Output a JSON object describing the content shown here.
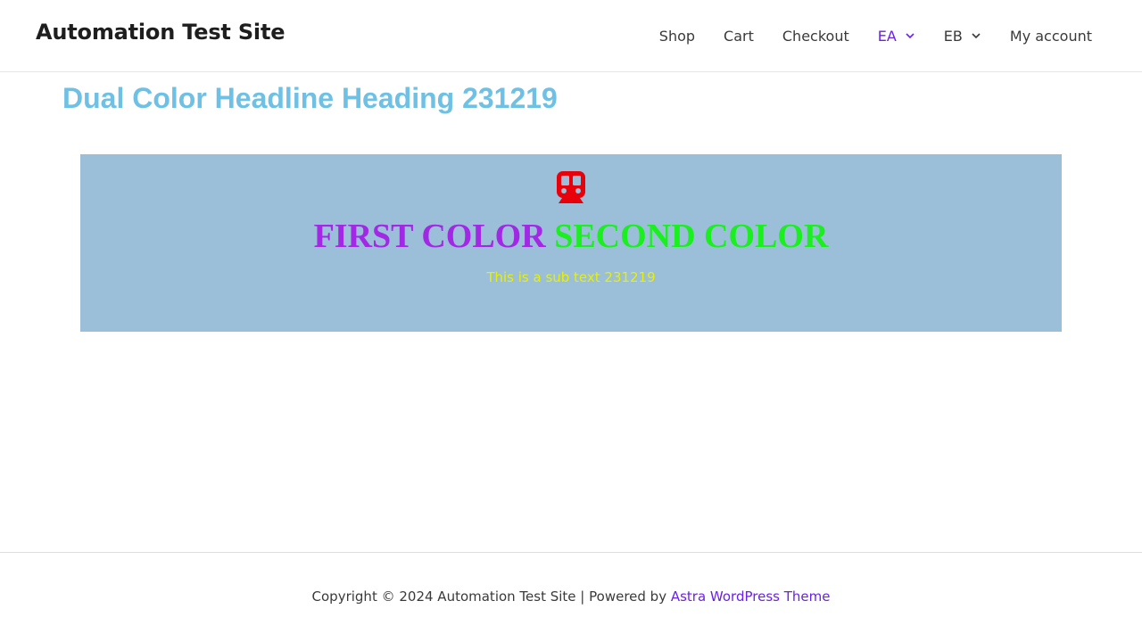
{
  "header": {
    "site_title": "Automation Test Site",
    "nav": [
      {
        "label": "Shop"
      },
      {
        "label": "Cart"
      },
      {
        "label": "Checkout"
      },
      {
        "label": "EA",
        "has_dropdown": true,
        "active": true
      },
      {
        "label": "EB",
        "has_dropdown": true
      },
      {
        "label": "My account"
      }
    ]
  },
  "main": {
    "heading": "Dual Color Headline Heading 231219",
    "dual_headline": {
      "icon": "subway-train-icon",
      "first": "FIRST COLOR",
      "second": "SECOND COLOR",
      "sub_text": "This is a sub text 231219"
    }
  },
  "footer": {
    "copyright": "Copyright © 2024 Automation Test Site | Powered by ",
    "link_text": "Astra WordPress Theme"
  },
  "colors": {
    "accent": "#6b21e8",
    "heading": "#6ec1e4",
    "box_bg": "#9bbfd8",
    "first_color": "#a228e6",
    "second_color": "#19f01d",
    "sub_text": "#e8f000",
    "icon": "#e8000b"
  }
}
